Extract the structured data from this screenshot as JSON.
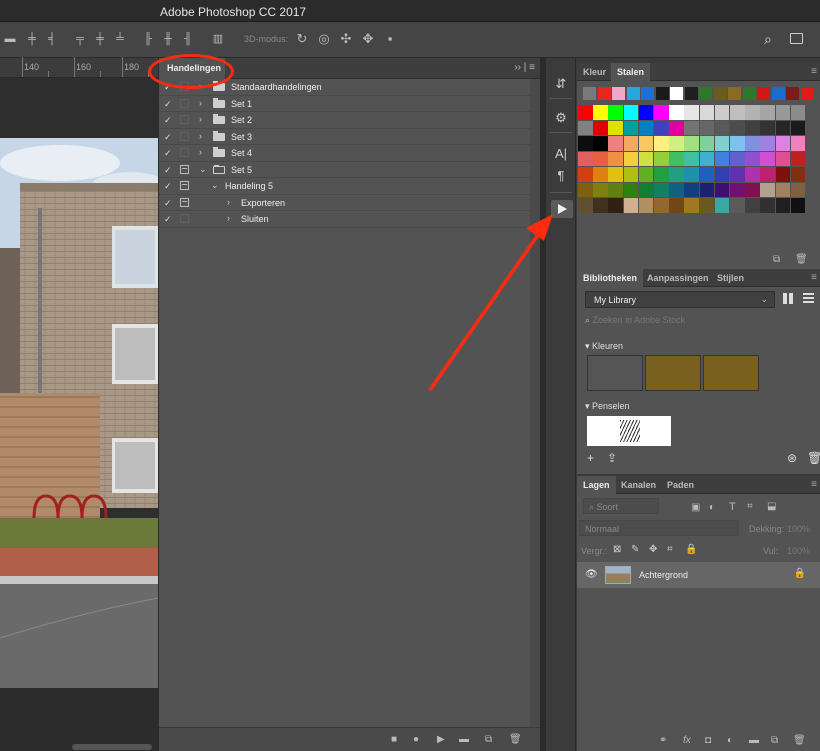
{
  "app": {
    "title": "Adobe Photoshop CC 2017"
  },
  "options_bar": {
    "mode_label": "3D-modus:"
  },
  "ruler": {
    "ticks": [
      "140",
      "160",
      "180"
    ]
  },
  "actions_panel": {
    "tab": "Handelingen",
    "rows": [
      {
        "label": "Standaardhandelingen",
        "checked": true,
        "dialog": false,
        "expanded": false,
        "level": 0,
        "folder": true
      },
      {
        "label": "Set 1",
        "checked": true,
        "dialog": false,
        "expanded": false,
        "level": 0,
        "folder": true
      },
      {
        "label": "Set 2",
        "checked": true,
        "dialog": false,
        "expanded": false,
        "level": 0,
        "folder": true
      },
      {
        "label": "Set 3",
        "checked": true,
        "dialog": false,
        "expanded": false,
        "level": 0,
        "folder": true
      },
      {
        "label": "Set 4",
        "checked": true,
        "dialog": false,
        "expanded": false,
        "level": 0,
        "folder": true
      },
      {
        "label": "Set 5",
        "checked": true,
        "dialog": true,
        "expanded": true,
        "level": 0,
        "folder": true
      },
      {
        "label": "Handeling 5",
        "checked": true,
        "dialog": true,
        "expanded": true,
        "level": 1,
        "folder": false
      },
      {
        "label": "Exporteren",
        "checked": true,
        "dialog": true,
        "expanded": false,
        "level": 2,
        "folder": false
      },
      {
        "label": "Sluiten",
        "checked": true,
        "dialog": false,
        "expanded": false,
        "level": 2,
        "folder": false
      }
    ],
    "footer_icons": [
      "stop-icon",
      "record-icon",
      "play-icon",
      "new-set-icon",
      "new-action-icon",
      "trash-icon"
    ]
  },
  "swatches_panel": {
    "tabs": [
      "Kleur",
      "Stalen"
    ],
    "active_tab": "Stalen",
    "top_row": [
      "#7a7a7a",
      "#e8261c",
      "#f0a8c8",
      "#27a6e0",
      "#1d6fd4",
      "#1a1a1a",
      "#ffffff",
      "#1f1f1f",
      "#2b7a2b",
      "#6b5b1a",
      "#8b6b20",
      "#2b7a2b",
      "#d01818",
      "#1a6ccf",
      "#7f1a1a",
      "#e01a1a"
    ],
    "grid": [
      [
        "#ff0000",
        "#ffff00",
        "#00ff00",
        "#00ffff",
        "#0000ff",
        "#ff00ff",
        "#ffffff",
        "#e6e6e6",
        "#d9d9d9",
        "#cccccc",
        "#bfbfbf",
        "#b3b3b3",
        "#a6a6a6",
        "#999999",
        "#8c8c8c"
      ],
      [
        "#808080",
        "#e00000",
        "#e0e000",
        "#00a0a0",
        "#0080c0",
        "#4040c0",
        "#e000a0",
        "#737373",
        "#666666",
        "#595959",
        "#4d4d4d",
        "#404040",
        "#333333",
        "#262626",
        "#1a1a1a"
      ],
      [
        "#0d0d0d",
        "#000000",
        "#f08080",
        "#f4a860",
        "#f8c860",
        "#fff080",
        "#d0f080",
        "#a0e080",
        "#80d0a0",
        "#80d0d0",
        "#80c0f0",
        "#8090e0",
        "#a080e0",
        "#e080e0",
        "#f080c0"
      ],
      [
        "#e06060",
        "#e86040",
        "#f09040",
        "#f0d040",
        "#d0e040",
        "#90d040",
        "#40c060",
        "#40c0a0",
        "#40b0d0",
        "#4080e0",
        "#6060d0",
        "#9050d0",
        "#d050d0",
        "#e05090",
        "#c02020"
      ],
      [
        "#d04010",
        "#e08010",
        "#e0c010",
        "#b0c010",
        "#60b020",
        "#20a040",
        "#20a080",
        "#2090b0",
        "#2060c0",
        "#3040b0",
        "#6030b0",
        "#b030b0",
        "#c02070",
        "#801010",
        "#803010"
      ],
      [
        "#806010",
        "#808010",
        "#608010",
        "#308010",
        "#108030",
        "#108060",
        "#106080",
        "#104080",
        "#202070",
        "#401070",
        "#701070",
        "#801050",
        "#b0a090",
        "#a08060",
        "#806040"
      ],
      [
        "#605030",
        "#403020",
        "#302010",
        "#d0b090",
        "#b09060",
        "#906830",
        "#704818",
        "#a07820",
        "#6a5a20",
        "#3aa8a0",
        "#5a5a5a",
        "#404040",
        "#303030",
        "#202020",
        "#101010"
      ]
    ]
  },
  "libraries_panel": {
    "tabs": [
      "Bibliotheken",
      "Aanpassingen",
      "Stijlen"
    ],
    "active_tab": "Bibliotheken",
    "library": "My Library",
    "search_placeholder": "Zoeken in Adobe Stock",
    "colors_section": "Kleuren",
    "colors": [
      "#555555",
      "#7a6020",
      "#7a6020"
    ],
    "brushes_section": "Penselen"
  },
  "layers_panel": {
    "tabs": [
      "Lagen",
      "Kanalen",
      "Paden"
    ],
    "active_tab": "Lagen",
    "filter": "Soort",
    "blend_mode": "Normaal",
    "opacity_label": "Dekking:",
    "opacity_value": "100%",
    "lock_label": "Vergr.:",
    "fill_label": "Vul:",
    "fill_value": "100%",
    "layer_name": "Achtergrond"
  }
}
